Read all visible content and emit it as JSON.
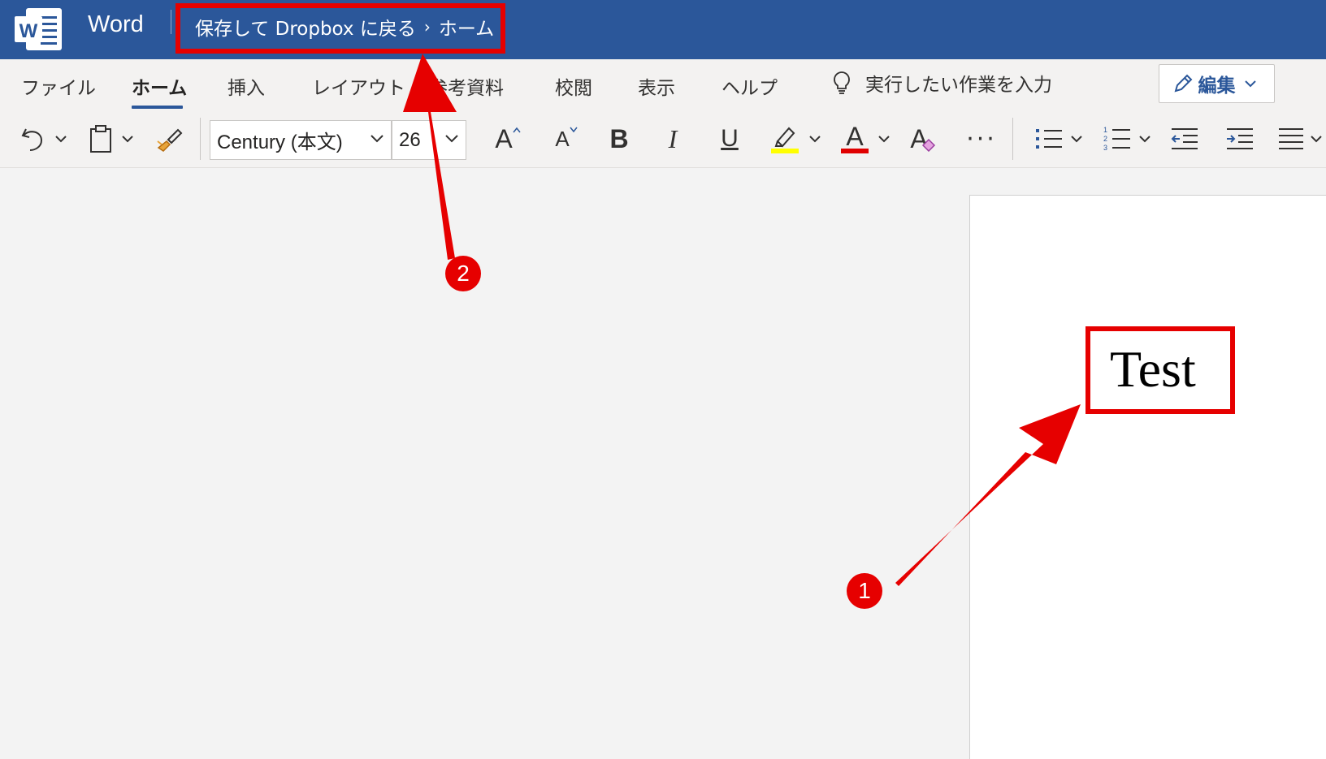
{
  "app": {
    "name": "Word"
  },
  "breadcrumb": {
    "back_label": "保存して Dropbox に戻る",
    "separator": "›",
    "current": "ホーム"
  },
  "tabs": [
    {
      "label": "ファイル"
    },
    {
      "label": "ホーム",
      "active": true
    },
    {
      "label": "挿入"
    },
    {
      "label": "レイアウト"
    },
    {
      "label": "参考資料"
    },
    {
      "label": "校閲"
    },
    {
      "label": "表示"
    },
    {
      "label": "ヘルプ"
    }
  ],
  "tell_me": {
    "placeholder": "実行したい作業を入力"
  },
  "edit_button": {
    "label": "編集"
  },
  "toolbar": {
    "font_name": "Century (本文)",
    "font_size": "26",
    "grow_font_glyph": "A",
    "shrink_font_glyph": "A",
    "bold_glyph": "B",
    "italic_glyph": "I",
    "underline_glyph": "U",
    "font_color_glyph": "A",
    "clear_format_glyph": "A",
    "more_glyph": "···"
  },
  "document": {
    "text": "Test"
  },
  "annotations": {
    "badge1": "1",
    "badge2": "2"
  },
  "colors": {
    "titlebar": "#2b579a",
    "annotation_red": "#e60000",
    "highlight_yellow": "#ffff00",
    "font_color_red": "#e00000"
  }
}
